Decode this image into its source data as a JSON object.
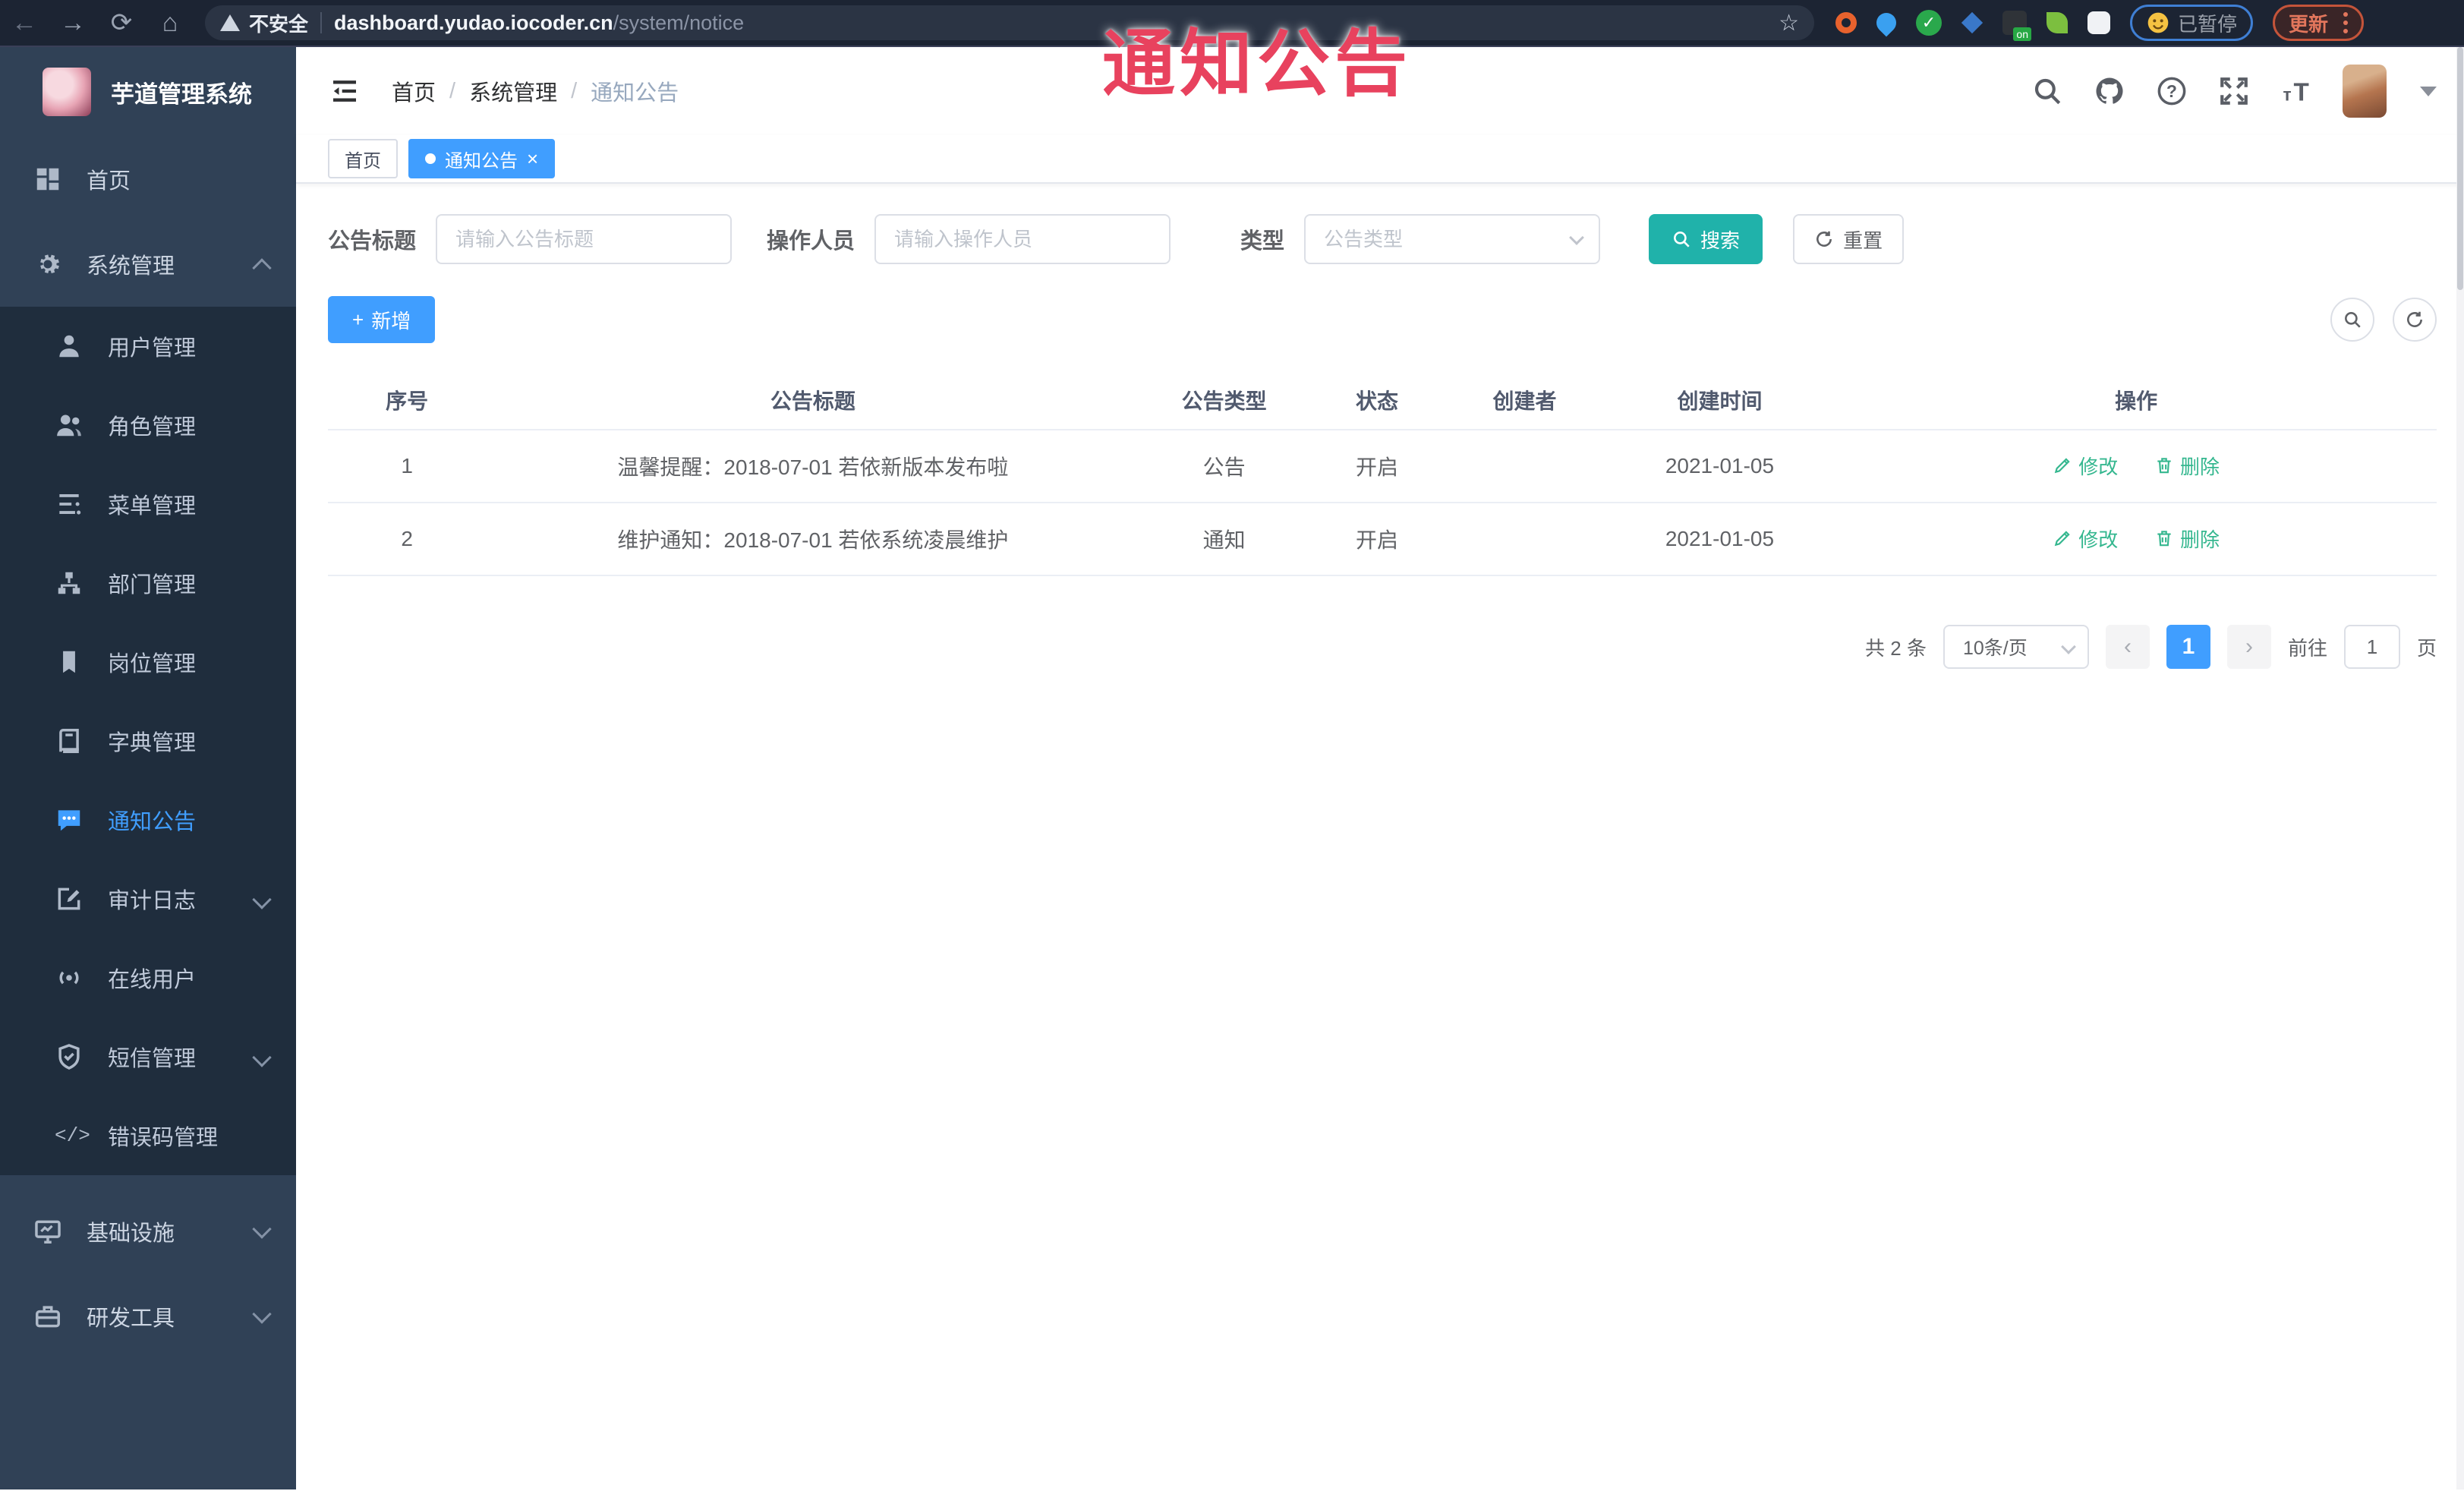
{
  "browser": {
    "security_label": "不安全",
    "url_host": "dashboard.yudao.iocoder.cn",
    "url_path": "/system/notice",
    "paused_label": "已暂停",
    "update_label": "更新",
    "star_glyph": "☆",
    "back_glyph": "←",
    "forward_glyph": "→",
    "reload_glyph": "⟳",
    "home_glyph": "⌂"
  },
  "overlay_title": "通知公告",
  "sidebar": {
    "app_title": "芋道管理系统",
    "home_label": "首页",
    "system_label": "系统管理",
    "items": [
      {
        "label": "用户管理"
      },
      {
        "label": "角色管理"
      },
      {
        "label": "菜单管理"
      },
      {
        "label": "部门管理"
      },
      {
        "label": "岗位管理"
      },
      {
        "label": "字典管理"
      },
      {
        "label": "通知公告"
      },
      {
        "label": "审计日志"
      },
      {
        "label": "在线用户"
      },
      {
        "label": "短信管理"
      },
      {
        "label": "错误码管理"
      }
    ],
    "code_glyph": "</>",
    "infra_label": "基础设施",
    "devtool_label": "研发工具"
  },
  "header": {
    "breadcrumb": {
      "home": "首页",
      "system": "系统管理",
      "current": "通知公告"
    },
    "separator": "/"
  },
  "tags": {
    "home_label": "首页",
    "active_label": "通知公告",
    "close_glyph": "×"
  },
  "filters": {
    "title_label": "公告标题",
    "title_placeholder": "请输入公告标题",
    "operator_label": "操作人员",
    "operator_placeholder": "请输入操作人员",
    "type_label": "类型",
    "type_placeholder": "公告类型",
    "search_label": "搜索",
    "reset_label": "重置"
  },
  "toolbar": {
    "add_label": "新增",
    "plus_glyph": "+"
  },
  "table": {
    "columns": [
      "序号",
      "公告标题",
      "公告类型",
      "状态",
      "创建者",
      "创建时间",
      "操作"
    ],
    "rows": [
      {
        "index": "1",
        "title": "温馨提醒：2018-07-01 若依新版本发布啦",
        "type": "公告",
        "status": "开启",
        "creator": "",
        "create_time": "2021-01-05",
        "edit_label": "修改",
        "delete_label": "删除"
      },
      {
        "index": "2",
        "title": "维护通知：2018-07-01 若依系统凌晨维护",
        "type": "通知",
        "status": "开启",
        "creator": "",
        "create_time": "2021-01-05",
        "edit_label": "修改",
        "delete_label": "删除"
      }
    ]
  },
  "pagination": {
    "total_text": "共 2 条",
    "page_size": "10条/页",
    "prev_glyph": "‹",
    "next_glyph": "›",
    "current_page": "1",
    "goto_label": "前往",
    "goto_value": "1",
    "page_unit": "页"
  },
  "colors": {
    "accent_blue": "#409EFF",
    "search_teal": "#20b2aa",
    "action_green": "#35b78f",
    "sidebar_bg": "#304156",
    "submenu_bg": "#1f2d3d",
    "overlay_red": "#e8425e"
  }
}
